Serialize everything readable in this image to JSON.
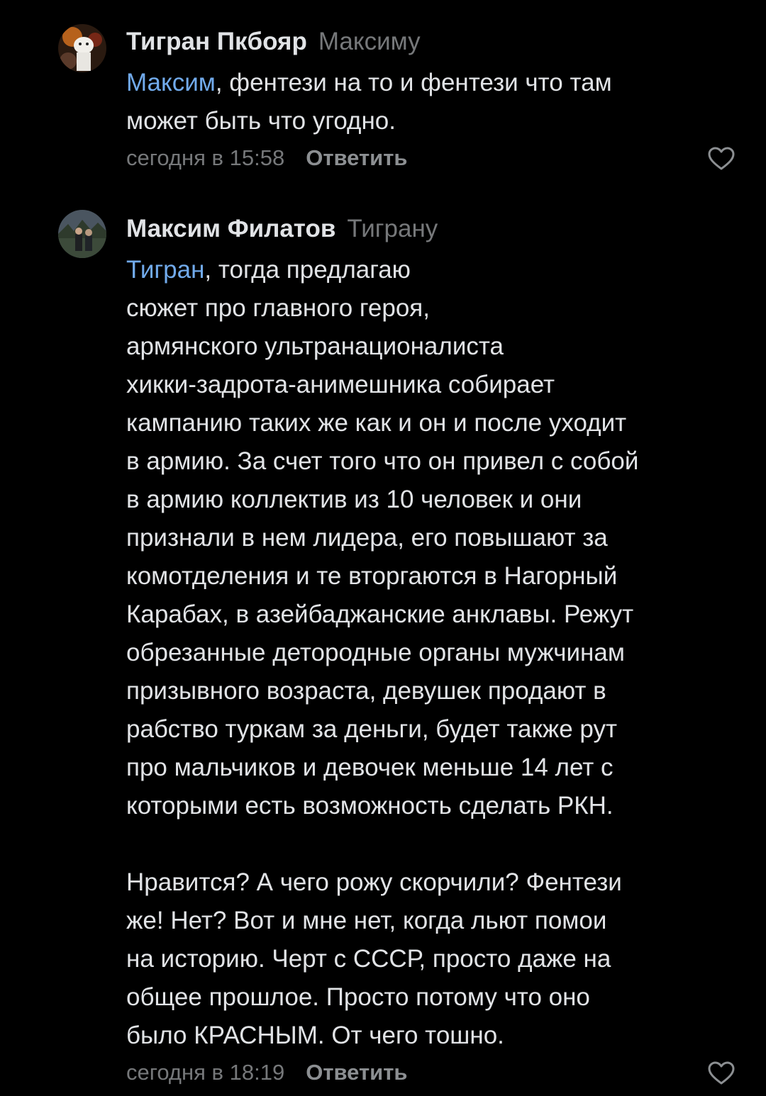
{
  "comments": [
    {
      "author": "Тигран Пкбояр",
      "reply_to": "Максиму",
      "mention": "Максим",
      "text": ", фентези на то и фентези что там\nможет быть что угодно.",
      "time": "сегодня в 15:58",
      "reply_label": "Ответить",
      "like_icon": "heart-outline"
    },
    {
      "author": "Максим Филатов",
      "reply_to": "Тиграну",
      "mention": "Тигран",
      "text": ", тогда предлагаю\nсюжет про главного героя,\nармянского ультранационалиста\nхикки-задрота-анимешника собирает\nкампанию таких же как и он и после уходит\nв армию. За счет того что он привел с собой\nв армию коллектив из 10 человек и они\nпризнали в нем лидера, его повышают за\nкомотделения и те вторгаются в Нагорный\nКарабах, в азейбаджанские анклавы. Режут\nобрезанные детородные органы мужчинам\nпризывного возраста, девушек продают в\nрабство туркам за деньги, будет также рут\nпро мальчиков и девочек меньше 14 лет с\nкоторыми есть возможность сделать РКН.\n\nНравится? А чего рожу скорчили? Фентези\nже! Нет? Вот и мне нет, когда льют помои\nна историю. Черт с СССР, просто даже на\nобщее прошлое. Просто потому что оно\nбыло КРАСНЫМ. От чего тошно.",
      "time": "сегодня в 18:19",
      "reply_label": "Ответить",
      "like_icon": "heart-outline"
    }
  ],
  "colors": {
    "background": "#000000",
    "text": "#e1e3e6",
    "mention": "#71aaeb",
    "secondary": "#76787a"
  }
}
